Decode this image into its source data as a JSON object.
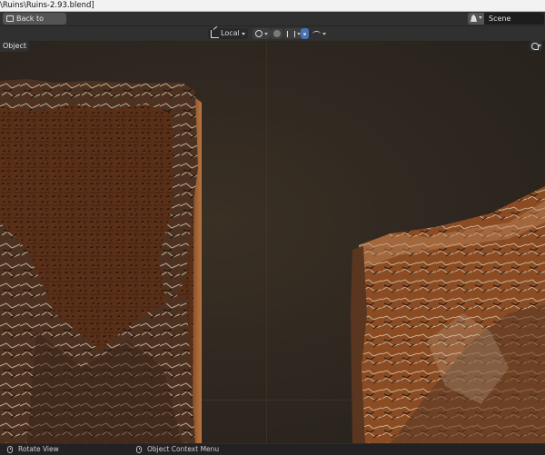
{
  "window": {
    "title_text": "\\Ruins\\Ruins-2.93.blend]"
  },
  "topbar": {
    "back_label": "Back to Previous",
    "scene_name": "Scene",
    "scene_icon": "scene-icon"
  },
  "header": {
    "orientation_value": "Local",
    "icons": [
      "transform-orientation-icon",
      "pivot-link-icon",
      "snap-icon",
      "snap-target-icon",
      "proportional-edit-icon",
      "falloff-curve-icon"
    ]
  },
  "viewport": {
    "mode_label": "Object",
    "background_color": "#2e2720",
    "stone_color_left": "#6e3c1e",
    "stone_color_right": "#8a4a22"
  },
  "statusbar": {
    "left_label": "Rotate View",
    "center_label": "Object Context Menu"
  }
}
